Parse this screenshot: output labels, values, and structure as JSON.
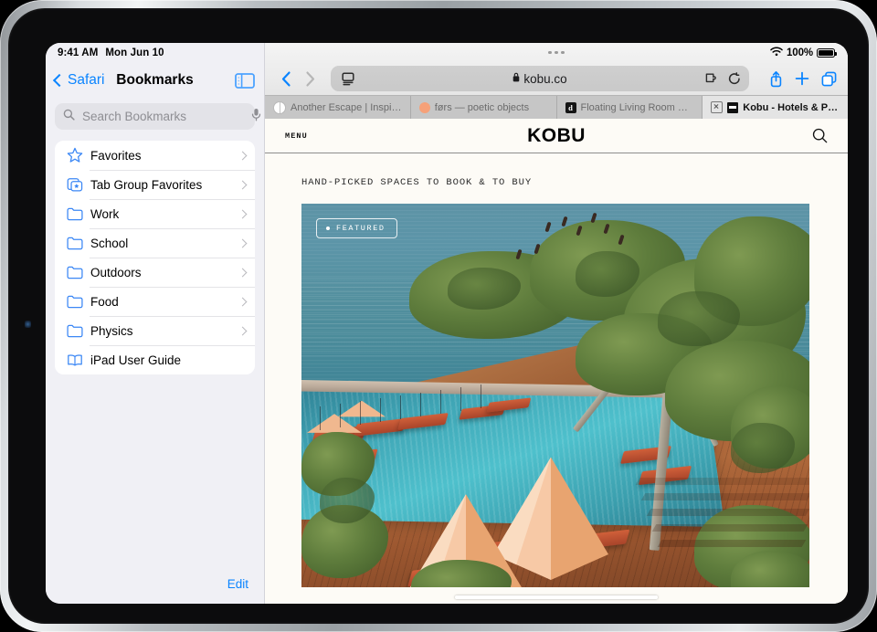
{
  "status_bar": {
    "time": "9:41 AM",
    "date": "Mon Jun 10",
    "battery_percent": "100%",
    "wifi_icon": "wifi-icon",
    "battery_icon": "battery-full-icon"
  },
  "sidebar": {
    "back_label": "Safari",
    "title": "Bookmarks",
    "toggle_icon": "sidebar-toggle-icon",
    "search": {
      "placeholder": "Search Bookmarks",
      "value": "",
      "search_icon": "search-icon",
      "dictation_icon": "microphone-icon"
    },
    "items": [
      {
        "label": "Favorites",
        "icon": "star-icon",
        "has_chevron": true
      },
      {
        "label": "Tab Group Favorites",
        "icon": "tab-group-icon",
        "has_chevron": true
      },
      {
        "label": "Work",
        "icon": "folder-icon",
        "has_chevron": true
      },
      {
        "label": "School",
        "icon": "folder-icon",
        "has_chevron": true
      },
      {
        "label": "Outdoors",
        "icon": "folder-icon",
        "has_chevron": true
      },
      {
        "label": "Food",
        "icon": "folder-icon",
        "has_chevron": true
      },
      {
        "label": "Physics",
        "icon": "folder-icon",
        "has_chevron": true
      },
      {
        "label": "iPad User Guide",
        "icon": "book-icon",
        "has_chevron": false
      }
    ],
    "edit_label": "Edit"
  },
  "browser": {
    "back_icon": "chevron-left-icon",
    "forward_icon": "chevron-right-icon",
    "reader_icon": "page-settings-icon",
    "lock_icon": "lock-icon",
    "url": "kobu.co",
    "extensions_icon": "extensions-puzzle-icon",
    "reload_icon": "reload-icon",
    "share_icon": "share-icon",
    "new_tab_icon": "plus-icon",
    "tab_overview_icon": "tab-overview-icon",
    "tabs": [
      {
        "title": "Another Escape | Inspir...",
        "favicon": "globe",
        "active": false
      },
      {
        "title": "førs — poetic objects",
        "favicon": "dot",
        "active": false
      },
      {
        "title": "Floating Living Room Se...",
        "favicon": "letter",
        "favicon_letter": "d",
        "active": false
      },
      {
        "title": "Kobu - Hotels & Propert...",
        "favicon": "kobu",
        "active": true
      }
    ]
  },
  "webpage": {
    "menu_label": "MENU",
    "logo": "KOBU",
    "search_icon": "search-icon",
    "tagline": "HAND-PICKED SPACES TO BOOK & TO BUY",
    "hero": {
      "badge_label": "FEATURED",
      "badge_dot": "bullet-dot",
      "alt": "Infinity pool terrace overlooking the ocean with orange loungers and peach umbrellas"
    }
  },
  "colors": {
    "accent_blue": "#0a84ff",
    "page_background": "#fdfbf6",
    "sidebar_background": "#f0f0f5",
    "ocean": "#54909f",
    "pool": "#4ec0cc",
    "deck": "#a85f38",
    "umbrella": "#f2b183",
    "lounger": "#c9582f"
  }
}
